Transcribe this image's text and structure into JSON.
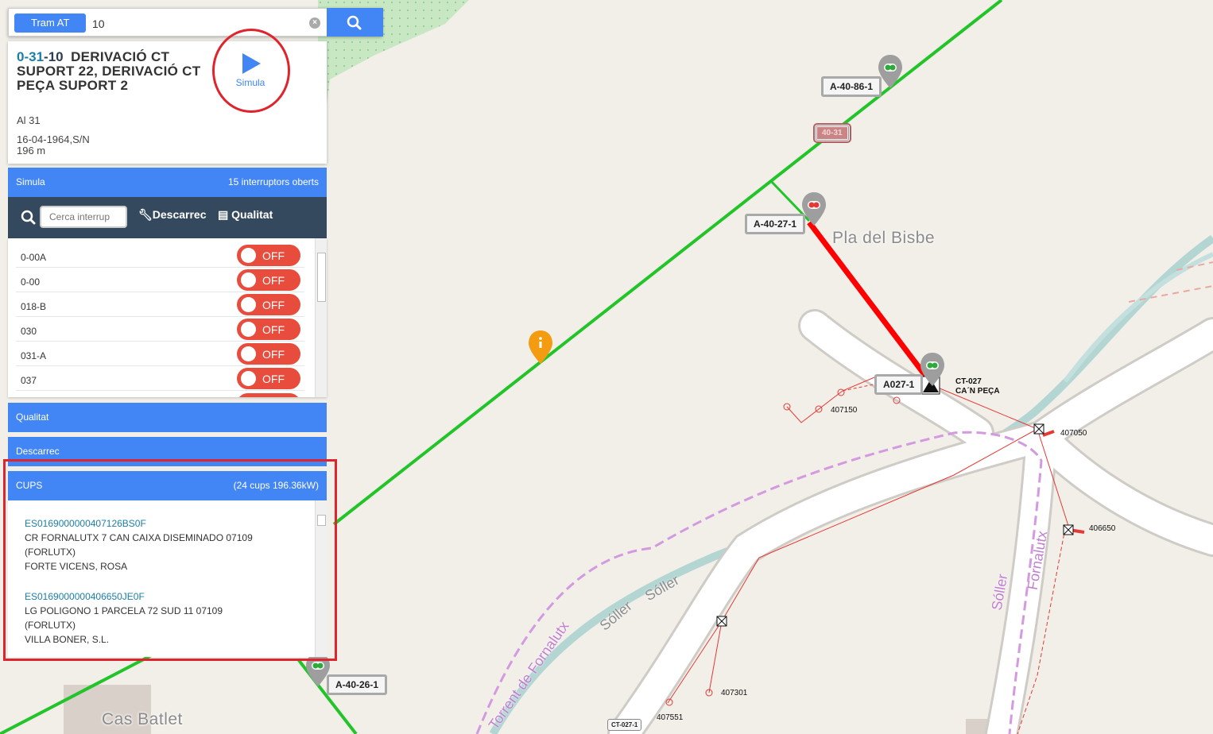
{
  "search": {
    "layer_label": "Tram AT",
    "value": "10"
  },
  "card": {
    "code_prefix": "0-31",
    "code_suffix": "-10",
    "name_line1": "DERIVACIÓ CT",
    "name_rest": "SUPORT 22, DERIVACIÓ CT PEÇA SUPORT 2",
    "conductor": "Al 31",
    "date": "16-04-1964,S/N",
    "length": "196 m",
    "simulate_label": "Simula"
  },
  "simula_section": {
    "title": "Simula",
    "summary": "15 interruptors oberts",
    "filter_placeholder": "Cerca interrup",
    "descarrec_label": "Descarrec",
    "qualitat_label": "Qualitat",
    "switches": [
      {
        "label": "0-00A",
        "state": "OFF"
      },
      {
        "label": "0-00",
        "state": "OFF"
      },
      {
        "label": "018-B",
        "state": "OFF"
      },
      {
        "label": "030",
        "state": "OFF"
      },
      {
        "label": "031-A",
        "state": "OFF"
      },
      {
        "label": "037",
        "state": "OFF"
      }
    ]
  },
  "qualitat_section": {
    "title": "Qualitat"
  },
  "descarrec_section": {
    "title": "Descarrec"
  },
  "cups_section": {
    "title": "CUPS",
    "summary": "(24 cups 196.36kW)",
    "items": [
      {
        "id": "ES0169000000407126BS0F",
        "address": "CR FORNALUTX 7 CAN CAIXA DISEMINADO 07109",
        "town": "(FORLUTX)",
        "holder": "FORTE VICENS, ROSA"
      },
      {
        "id": "ES0169000000406650JE0F",
        "address": "LG POLIGONO 1 PARCELA 72 SUD 11 07109",
        "town": "(FORLUTX)",
        "holder": "VILLA BONER, S.L."
      }
    ]
  },
  "map": {
    "labels": {
      "a40861": "A-40-86-1",
      "a40271": "A-40-27-1",
      "a0271": "A027-1",
      "a40261": "A-40-26-1",
      "red_tag": "40-31",
      "ct_code": "CT-027",
      "ct_name": "CA´N PEÇA",
      "ct_small": "CT-027-1"
    },
    "nodes": [
      "407150",
      "407050",
      "406650",
      "407301",
      "407551"
    ],
    "places": {
      "pla_bisbe": "Pla del Bisbe",
      "cas_batlet": "Cas Batlet"
    },
    "roads": {
      "soller1": "Sóller",
      "soller2": "Sóller",
      "soller3": "Sóller",
      "fornalutx1": "Fornalutx",
      "fornalutx2": "Torrent de Fornalutx"
    },
    "colors": {
      "line_green": "#22c42a",
      "line_red": "#ff0000",
      "accent_blue": "#4285f4",
      "toolbar_dark": "#34495e",
      "toggle_red": "#e74c3c",
      "marker_orange": "#f39c12"
    }
  }
}
